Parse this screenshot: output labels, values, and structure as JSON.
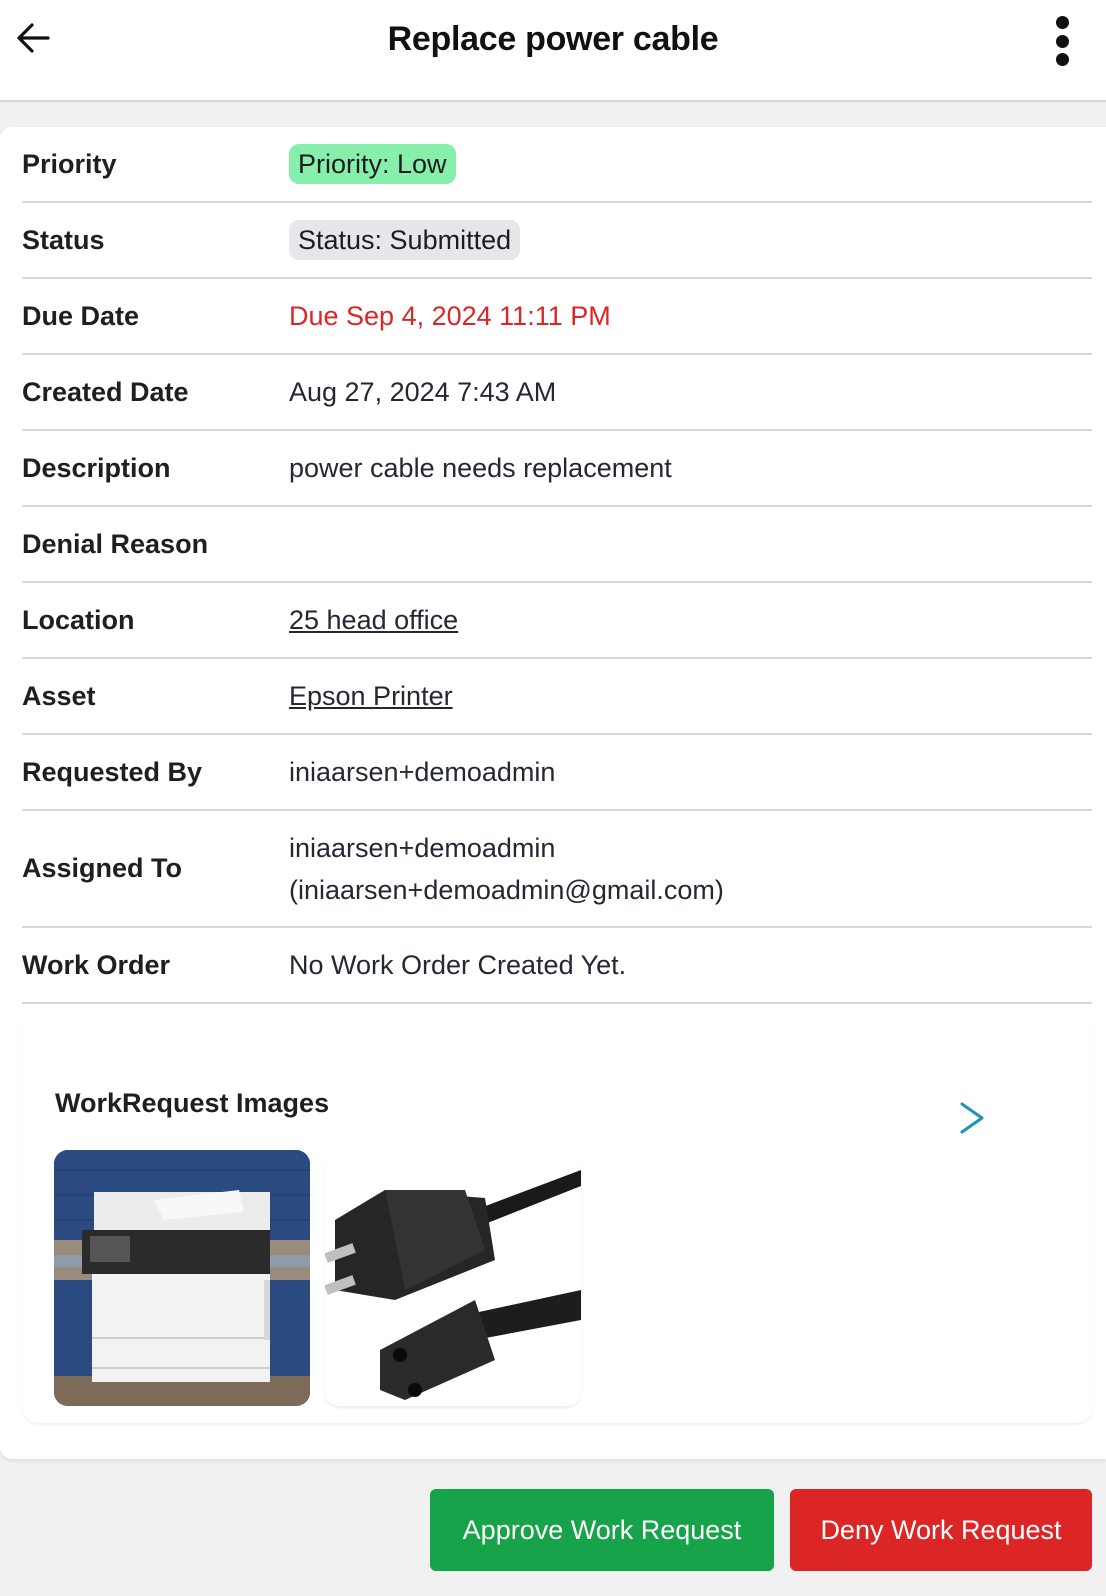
{
  "header": {
    "title": "Replace power cable",
    "back_icon": "arrow-left-icon",
    "menu_icon": "more-vertical-icon"
  },
  "details": {
    "priority": {
      "label": "Priority",
      "value": "Priority: Low",
      "color": "#86efac"
    },
    "status": {
      "label": "Status",
      "value": "Status: Submitted",
      "color": "#e5e7eb"
    },
    "due_date": {
      "label": "Due Date",
      "value": "Due Sep 4, 2024 11:11 PM",
      "color": "#dc2626"
    },
    "created_date": {
      "label": "Created Date",
      "value": "Aug 27, 2024 7:43 AM"
    },
    "description": {
      "label": "Description",
      "value": "power cable needs replacement"
    },
    "denial_reason": {
      "label": "Denial Reason",
      "value": ""
    },
    "location": {
      "label": "Location",
      "value": "25 head office"
    },
    "asset": {
      "label": "Asset",
      "value": "Epson Printer"
    },
    "requested_by": {
      "label": "Requested By",
      "value": "iniaarsen+demoadmin"
    },
    "assigned_to": {
      "label": "Assigned To",
      "name": "iniaarsen+demoadmin",
      "email": "(iniaarsen+demoadmin@gmail.com)"
    },
    "work_order": {
      "label": "Work Order",
      "value": "No Work Order Created Yet."
    }
  },
  "images": {
    "title": "WorkRequest Images",
    "next_icon": "chevron-right-icon",
    "items": [
      {
        "alt": "printer photo"
      },
      {
        "alt": "power cable photo"
      }
    ]
  },
  "actions": {
    "approve_label": "Approve Work Request",
    "approve_color": "#16a34a",
    "deny_label": "Deny Work Request",
    "deny_color": "#dc2626"
  }
}
